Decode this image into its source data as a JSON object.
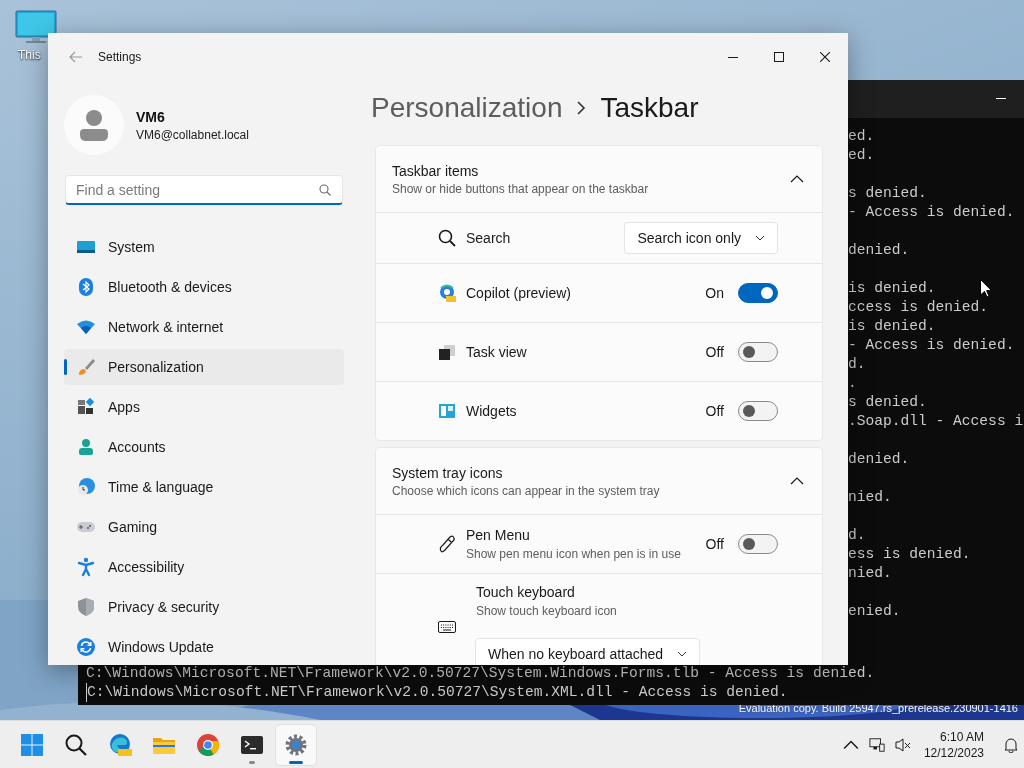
{
  "desktop": {
    "icons": [
      {
        "label": "This"
      }
    ],
    "watermark": "Evaluation copy. Build 25947.rs_prerelease.230901-1416"
  },
  "console_window": {
    "fragments": [
      [
        "ed.",
        "ed."
      ],
      [
        "s denied.",
        "- Access is denied."
      ],
      [
        "denied."
      ],
      [
        "is denied.",
        "ccess is denied.",
        "is denied.",
        "- Access is denied.",
        "d.",
        ".",
        "s denied.",
        ".Soap.dll - Access i"
      ],
      [
        "denied."
      ],
      [
        "nied."
      ],
      [
        "d.",
        "ess is denied.",
        "nied."
      ],
      [
        "enied."
      ]
    ],
    "lines": [
      "C:\\Windows\\Microsoft.NET\\Framework\\v2.0.50727\\System.Windows.Forms.tlb - Access is denied.",
      "C:\\Windows\\Microsoft.NET\\Framework\\v2.0.50727\\System.XML.dll - Access is denied."
    ]
  },
  "settings_window": {
    "title": "Settings",
    "user": {
      "name": "VM6",
      "email": "VM6@collabnet.local"
    },
    "search": {
      "placeholder": "Find a setting"
    },
    "nav": [
      {
        "label": "System",
        "selected": false
      },
      {
        "label": "Bluetooth & devices",
        "selected": false
      },
      {
        "label": "Network & internet",
        "selected": false
      },
      {
        "label": "Personalization",
        "selected": true
      },
      {
        "label": "Apps",
        "selected": false
      },
      {
        "label": "Accounts",
        "selected": false
      },
      {
        "label": "Time & language",
        "selected": false
      },
      {
        "label": "Gaming",
        "selected": false
      },
      {
        "label": "Accessibility",
        "selected": false
      },
      {
        "label": "Privacy & security",
        "selected": false
      },
      {
        "label": "Windows Update",
        "selected": false
      }
    ],
    "breadcrumb": [
      "Personalization",
      "Taskbar"
    ],
    "sections": [
      {
        "title": "Taskbar items",
        "subtitle": "Show or hide buttons that appear on the taskbar",
        "expanded": true,
        "rows": [
          {
            "kind": "dropdown",
            "label": "Search",
            "value": "Search icon only"
          },
          {
            "kind": "toggle",
            "label": "Copilot (preview)",
            "on": true,
            "state_text": "On"
          },
          {
            "kind": "toggle",
            "label": "Task view",
            "on": false,
            "state_text": "Off"
          },
          {
            "kind": "toggle",
            "label": "Widgets",
            "on": false,
            "state_text": "Off"
          }
        ]
      },
      {
        "title": "System tray icons",
        "subtitle": "Choose which icons can appear in the system tray",
        "expanded": true,
        "rows": [
          {
            "kind": "toggle",
            "label": "Pen Menu",
            "description": "Show pen menu icon when pen is in use",
            "on": false,
            "state_text": "Off"
          },
          {
            "kind": "dropdown-below",
            "label": "Touch keyboard",
            "description": "Show touch keyboard icon",
            "value": "When no keyboard attached"
          }
        ]
      }
    ]
  },
  "taskbar": {
    "apps": [
      {
        "running": false,
        "active": false
      },
      {
        "running": false,
        "active": false
      },
      {
        "running": false,
        "active": false
      },
      {
        "running": false,
        "active": false
      },
      {
        "running": true,
        "active": false
      },
      {
        "running": true,
        "active": true
      }
    ],
    "clock": {
      "time": "6:10 AM",
      "date": "12/12/2023"
    }
  }
}
